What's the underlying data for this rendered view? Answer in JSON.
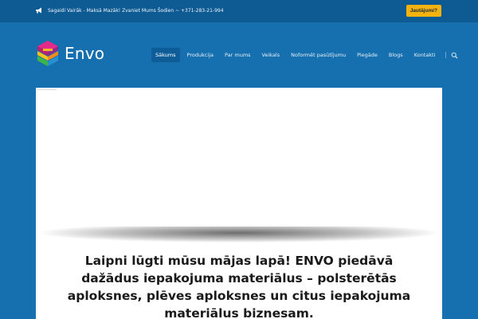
{
  "topbar": {
    "notice_icon": "megaphone-icon",
    "notice_text": "Sagaidi Vairāk - Maksā Mazāk! Zvaniet Mums Šodien ~ +371-283-21-994",
    "question_label": "Jautājumi?",
    "accent_color": "#f5b30f"
  },
  "header": {
    "logo_text": "Envo",
    "logo_icon": "stacked-boxes-logo-icon"
  },
  "nav": {
    "items": [
      {
        "label": "Sākums",
        "active": true
      },
      {
        "label": "Produkcija",
        "active": false
      },
      {
        "label": "Par mums",
        "active": false
      },
      {
        "label": "Veikals",
        "active": false
      },
      {
        "label": "Noformēt pasūtījumu",
        "active": false
      },
      {
        "label": "Piegāde",
        "active": false
      },
      {
        "label": "Blogs",
        "active": false
      },
      {
        "label": "Kontakti",
        "active": false
      }
    ],
    "search_icon": "search-icon"
  },
  "main": {
    "welcome_text": "Laipni lūgti mūsu mājas lapā! ENVO piedāvā dažādus iepakojuma materiālus – polsterētās aploksnes, plēves aploksnes un citus iepakojuma materiālus biznesam."
  },
  "colors": {
    "background": "#1670b0",
    "topbar": "#0e5a93",
    "nav_active": "#0f5d98"
  }
}
